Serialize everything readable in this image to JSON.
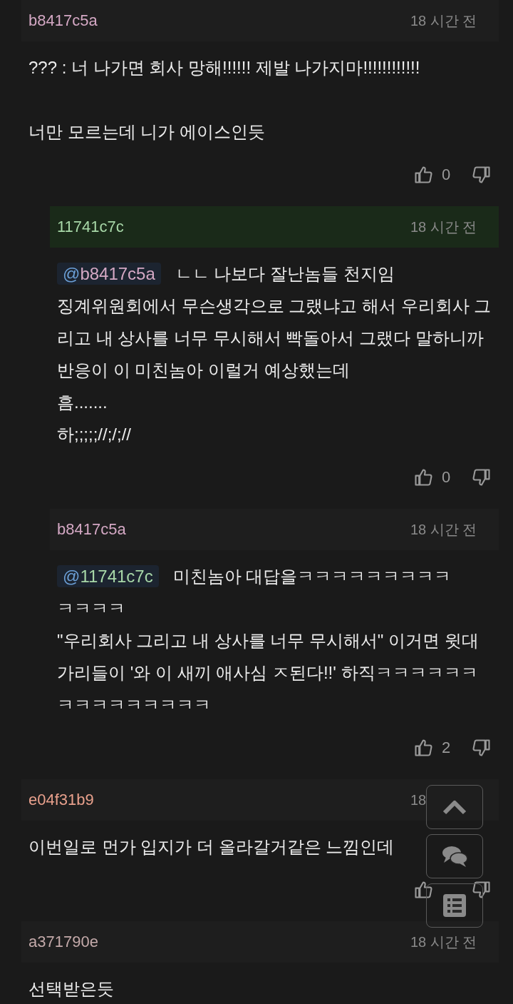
{
  "comments": [
    {
      "author": "b8417c5a",
      "color": "#d4a8c4",
      "time": "18 시간 전",
      "highlighted": false,
      "paragraphs": [
        [
          "??? : 너 나가면 회사 망해!!!!!! 제발 나가지마!!!!!!!!!!!!"
        ],
        [
          "너만 모르는데 니가 에이스인듯"
        ]
      ],
      "likes": "0",
      "replies": [
        {
          "author": "11741c7c",
          "color": "#a8d8a8",
          "time": "18 시간 전",
          "highlighted": true,
          "mention": {
            "text": "@b8417c5a",
            "color": "#d4a8c4"
          },
          "paragraphs": [
            [
              "ㄴㄴ 나보다 잘난놈들 천지임",
              "징계위원회에서 무슨생각으로 그랬냐고 해서 우리회사 그리고 내 상사를 너무 무시해서 빡돌아서 그랬다 말하니까",
              "반응이 이 미친놈아 이럴거 예상했는데",
              "흠.......",
              "하;;;;;//;/;//"
            ]
          ],
          "likes": "0"
        },
        {
          "author": "b8417c5a",
          "color": "#d4a8c4",
          "time": "18 시간 전",
          "highlighted": false,
          "mention": {
            "text": "@11741c7c",
            "color": "#a8d8a8"
          },
          "paragraphs": [
            [
              "미친놈아 대답을ㅋㅋㅋㅋㅋㅋㅋㅋㅋ",
              "ㅋㅋㅋㅋ",
              "\"우리회사 그리고 내 상사를 너무 무시해서\" 이거면 윗대가리들이 '와 이 새끼 애사심 ㅈ된다!!' 하직ㅋㅋㅋㅋㅋㅋㅋㅋㅋㅋㅋㅋㅋㅋㅋ"
            ]
          ],
          "likes": "2"
        }
      ]
    },
    {
      "author": "e04f31b9",
      "color": "#e8a08c",
      "time": "18",
      "highlighted": false,
      "paragraphs": [
        [
          "이번일로 먼가 입지가 더 올라갈거같은 느낌인데"
        ]
      ],
      "votes": true
    },
    {
      "author": "a371790e",
      "color": "#c4aaaa",
      "time": "18 시간 전",
      "highlighted": false,
      "paragraphs": [
        [
          "선택받은듯"
        ]
      ]
    }
  ],
  "floating_buttons": [
    {
      "kind": "top"
    },
    {
      "kind": "comments"
    },
    {
      "kind": "list"
    }
  ]
}
